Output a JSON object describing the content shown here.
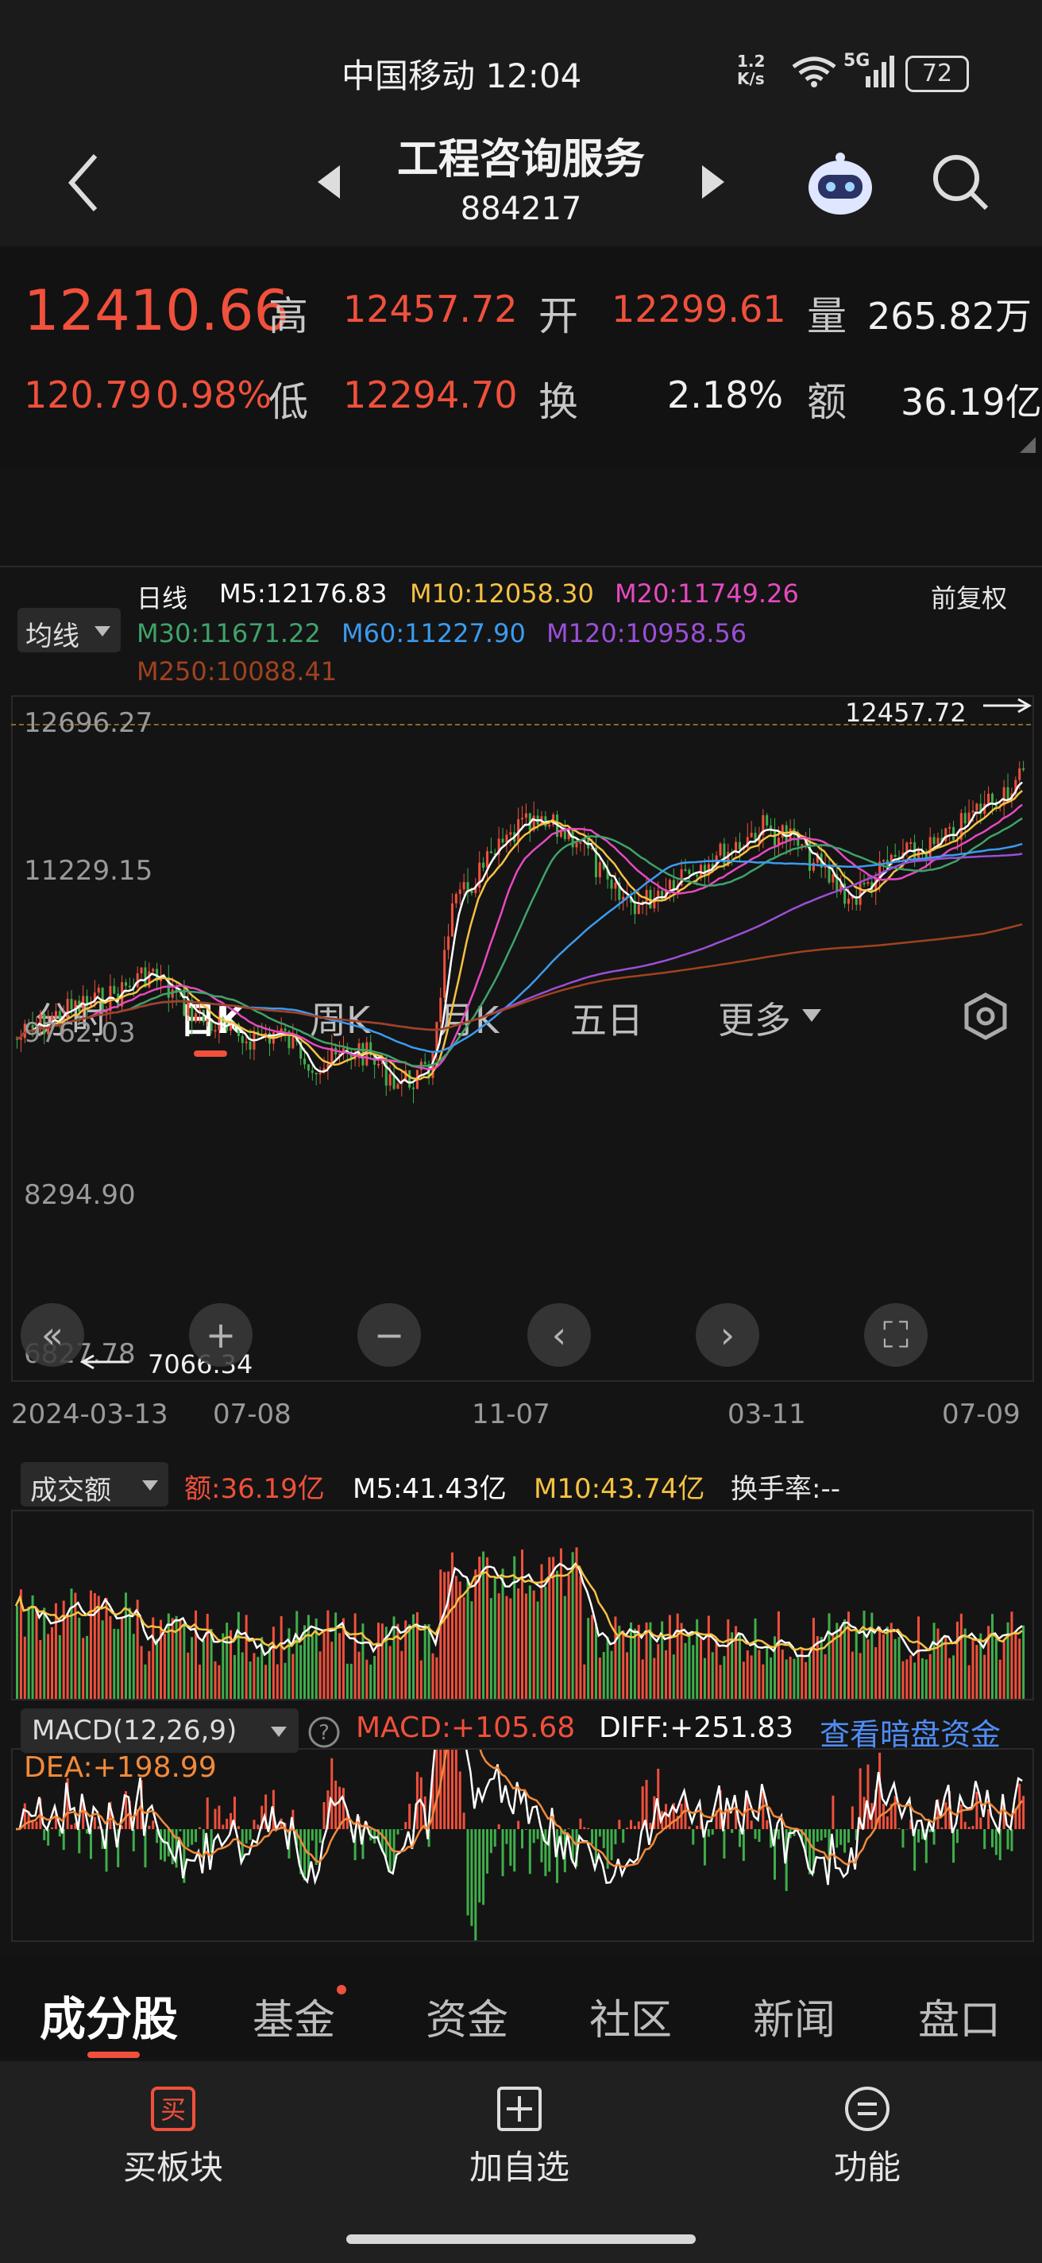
{
  "status": {
    "time": "中国移动 12:04",
    "net": "1.2\nK/s",
    "net_speed": "1.2",
    "net_unit": "K/s",
    "battery": "72",
    "signal": "5G"
  },
  "header": {
    "title": "工程咨询服务",
    "code": "884217"
  },
  "quote": {
    "price": "12410.66",
    "change": "120.79",
    "change_pct": "0.98%",
    "high_label": "高",
    "high": "12457.72",
    "open_label": "开",
    "open": "12299.61",
    "vol_label": "量",
    "vol": "265.82万",
    "low_label": "低",
    "low": "12294.70",
    "turn_label": "换",
    "turn": "2.18%",
    "amt_label": "额",
    "amt": "36.19亿"
  },
  "tabs": {
    "items": [
      "分时",
      "日K",
      "周K",
      "月K",
      "五日",
      "更多"
    ],
    "active": "日K"
  },
  "ma": {
    "type_label": "均线",
    "period": "日线",
    "adjust": "前复权",
    "m5": "M5:12176.83",
    "m10": "M10:12058.30",
    "m20": "M20:11749.26",
    "m30": "M30:11671.22",
    "m60": "M60:11227.90",
    "m120": "M120:10958.56",
    "m250": "M250:10088.41"
  },
  "kline": {
    "y_labels": [
      "12696.27",
      "11229.15",
      "9762.03",
      "8294.90",
      "6827.78"
    ],
    "high_mark": "12457.72",
    "low_mark": "7066.34",
    "x_labels": [
      "2024-03-13",
      "07-08",
      "11-07",
      "03-11",
      "07-09"
    ]
  },
  "volume": {
    "label": "成交额",
    "amount": "额:36.19亿",
    "m5": "M5:41.43亿",
    "m10": "M10:43.74亿",
    "turnover": "换手率:--"
  },
  "macd": {
    "label": "MACD(12,26,9)",
    "macd": "MACD:+105.68",
    "diff": "DIFF:+251.83",
    "dea": "DEA:+198.99",
    "link": "查看暗盘资金"
  },
  "bottom_tabs": {
    "items": [
      "成分股",
      "基金",
      "资金",
      "社区",
      "新闻",
      "盘口"
    ],
    "active": "成分股"
  },
  "bottom_bar": {
    "buy": "买板块",
    "add": "加自选",
    "func": "功能"
  },
  "colors": {
    "up": "#f0503c",
    "down": "#3fae4a",
    "m5": "#ffffff",
    "m10": "#f5c242",
    "m20": "#e64ac0",
    "m30": "#3fa36a",
    "m60": "#3b9bf0",
    "m120": "#9b4fd6",
    "m250": "#a0421f",
    "link": "#4f8df5"
  }
}
